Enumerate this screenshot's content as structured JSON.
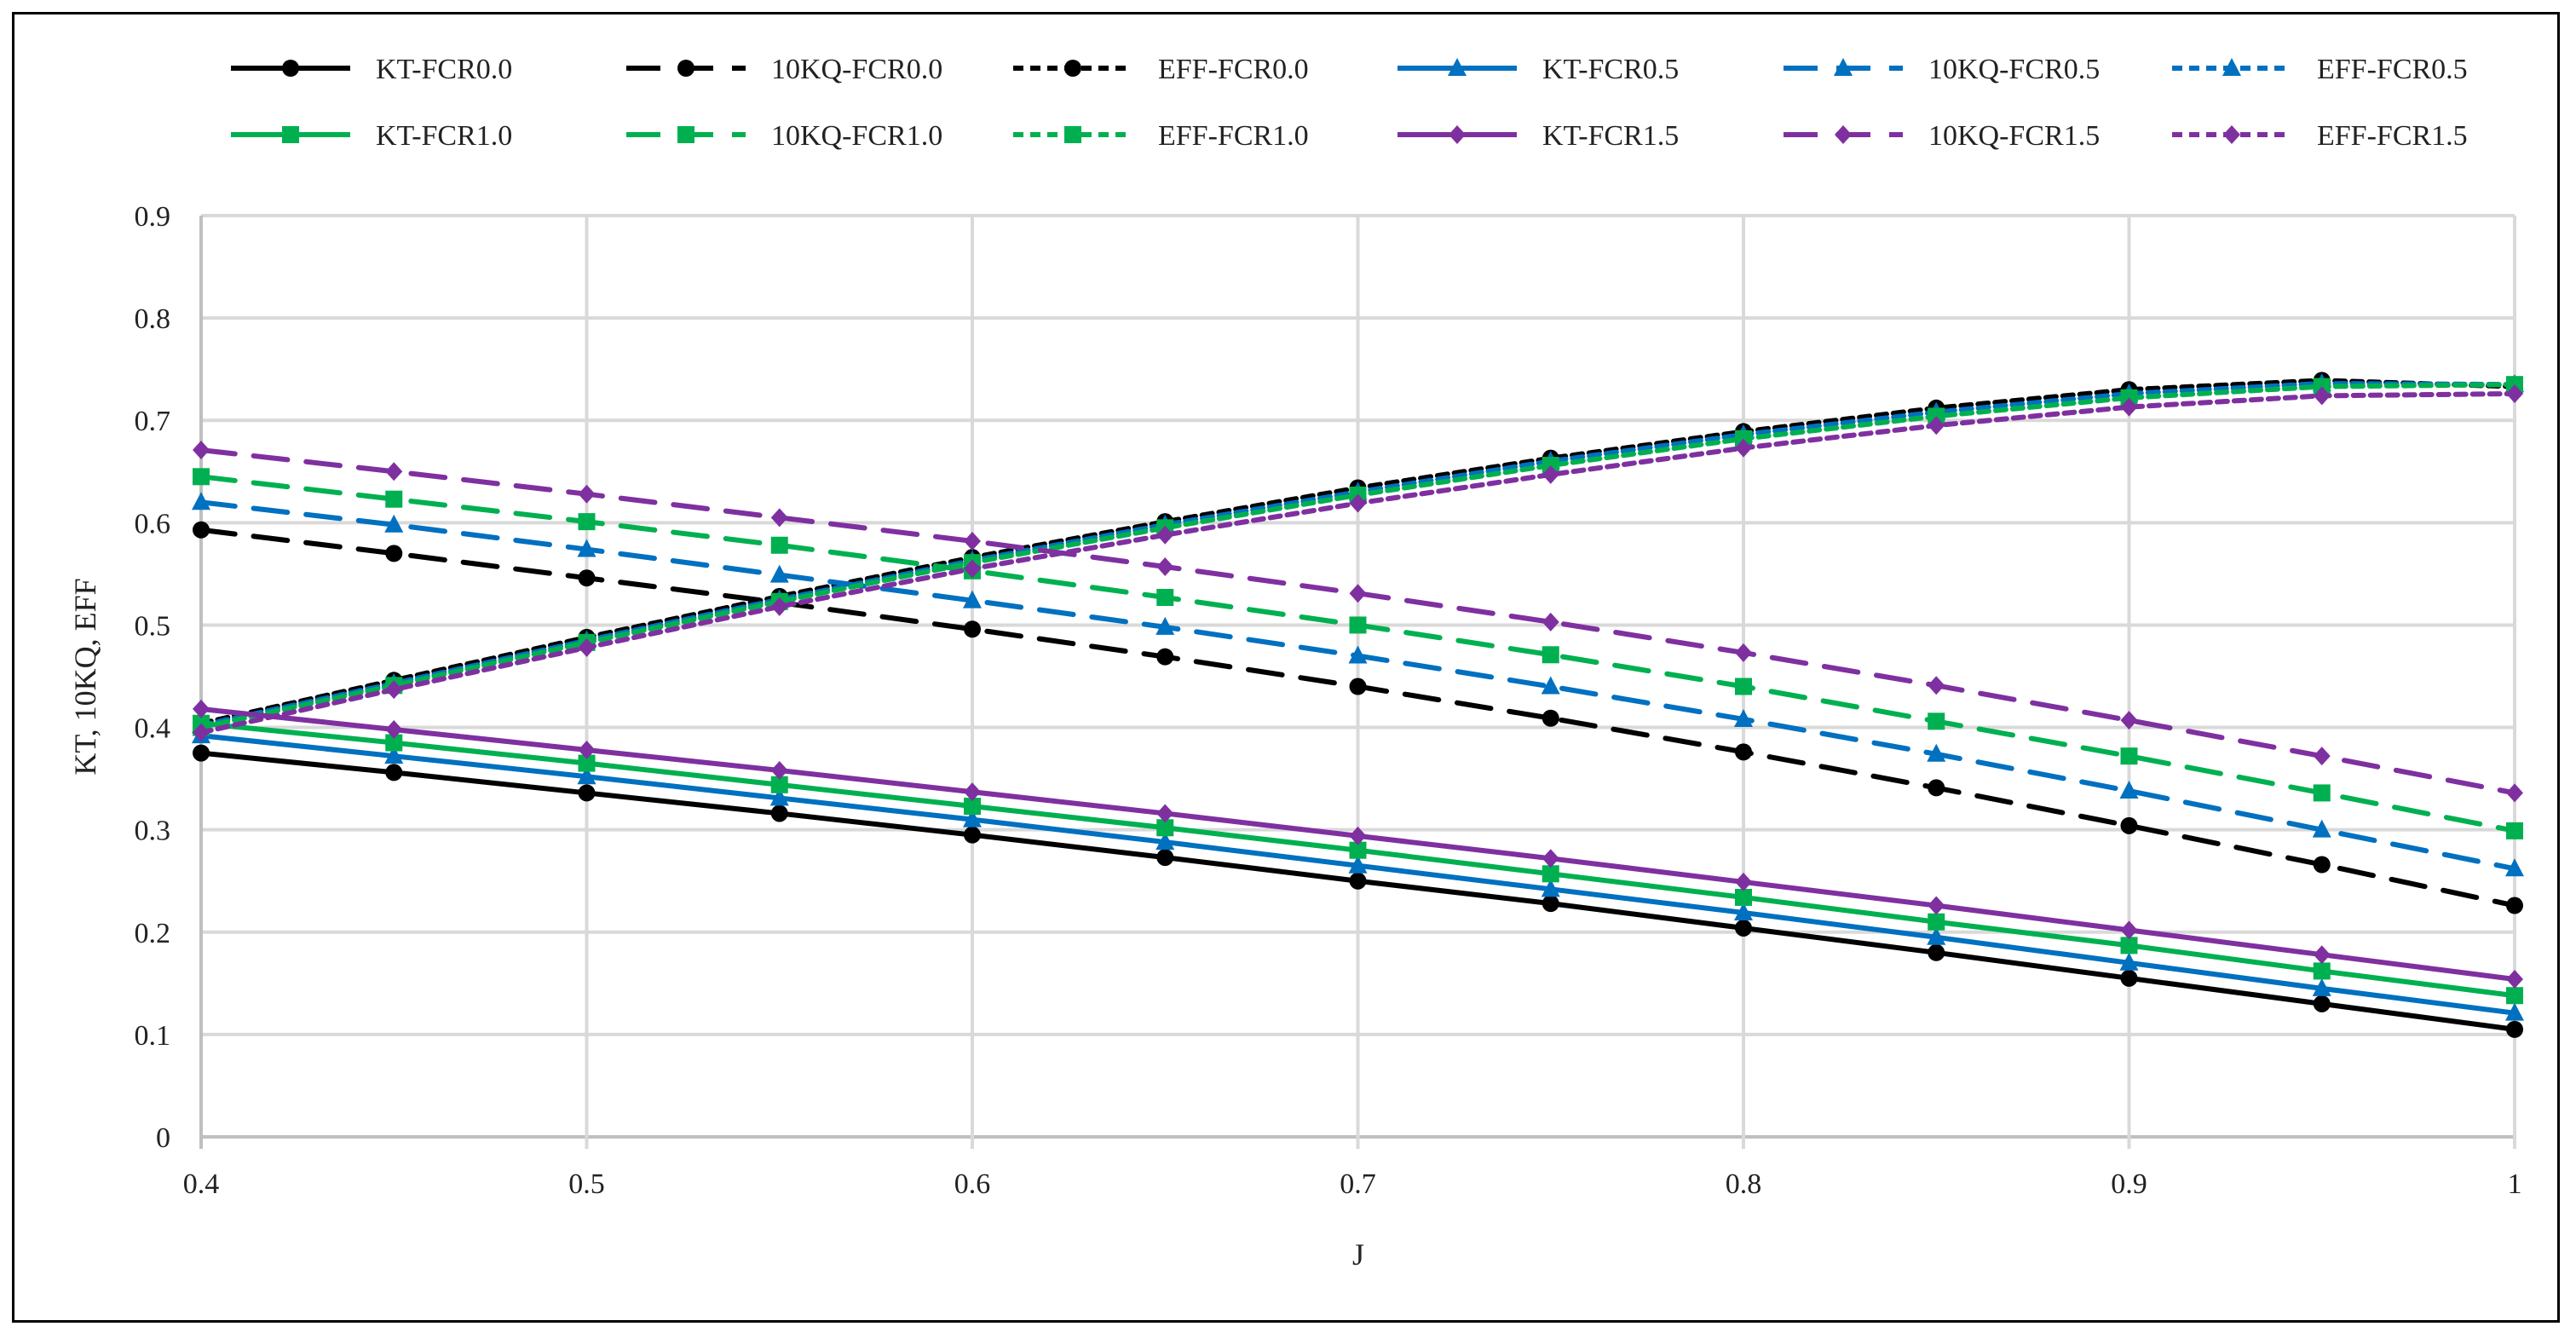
{
  "chart_data": {
    "type": "line",
    "title": "",
    "xlabel": "J",
    "ylabel": "KT, 10KQ, EFF",
    "xlim": [
      0.4,
      1.0
    ],
    "ylim": [
      0,
      0.9
    ],
    "x_ticks": [
      "0.4",
      "0.5",
      "0.6",
      "0.7",
      "0.8",
      "0.9",
      "1"
    ],
    "y_ticks": [
      "0",
      "0.1",
      "0.2",
      "0.3",
      "0.4",
      "0.5",
      "0.6",
      "0.7",
      "0.8",
      "0.9"
    ],
    "grid": true,
    "legend_position": "top",
    "x": [
      0.4,
      0.45,
      0.5,
      0.55,
      0.6,
      0.65,
      0.7,
      0.75,
      0.8,
      0.85,
      0.9,
      0.95,
      1.0
    ],
    "series": [
      {
        "name": "KT-FCR0.0",
        "color": "#000000",
        "style": "solid",
        "marker": "circle",
        "values": [
          0.375,
          0.356,
          0.336,
          0.316,
          0.295,
          0.273,
          0.25,
          0.228,
          0.204,
          0.18,
          0.155,
          0.13,
          0.105
        ]
      },
      {
        "name": "10KQ-FCR0.0",
        "color": "#000000",
        "style": "dash",
        "marker": "circle",
        "values": [
          0.593,
          0.57,
          0.546,
          0.522,
          0.496,
          0.469,
          0.44,
          0.409,
          0.376,
          0.341,
          0.304,
          0.266,
          0.226
        ]
      },
      {
        "name": "EFF-FCR0.0",
        "color": "#000000",
        "style": "dot",
        "marker": "circle",
        "values": [
          0.404,
          0.446,
          0.488,
          0.528,
          0.566,
          0.601,
          0.634,
          0.663,
          0.689,
          0.712,
          0.73,
          0.739,
          0.733
        ]
      },
      {
        "name": "KT-FCR0.5",
        "color": "#0070c0",
        "style": "solid",
        "marker": "triangle",
        "values": [
          0.392,
          0.372,
          0.352,
          0.331,
          0.31,
          0.288,
          0.265,
          0.242,
          0.219,
          0.195,
          0.17,
          0.145,
          0.121
        ]
      },
      {
        "name": "10KQ-FCR0.5",
        "color": "#0070c0",
        "style": "dash",
        "marker": "triangle",
        "values": [
          0.62,
          0.598,
          0.574,
          0.549,
          0.524,
          0.498,
          0.47,
          0.44,
          0.408,
          0.374,
          0.338,
          0.3,
          0.262
        ]
      },
      {
        "name": "EFF-FCR0.5",
        "color": "#0070c0",
        "style": "dot",
        "marker": "triangle",
        "values": [
          0.402,
          0.443,
          0.485,
          0.525,
          0.563,
          0.598,
          0.63,
          0.66,
          0.686,
          0.708,
          0.726,
          0.736,
          0.735
        ]
      },
      {
        "name": "KT-FCR1.0",
        "color": "#00b050",
        "style": "solid",
        "marker": "square",
        "values": [
          0.404,
          0.385,
          0.365,
          0.344,
          0.323,
          0.302,
          0.28,
          0.257,
          0.234,
          0.21,
          0.187,
          0.162,
          0.138
        ]
      },
      {
        "name": "10KQ-FCR1.0",
        "color": "#00b050",
        "style": "dash",
        "marker": "square",
        "values": [
          0.645,
          0.623,
          0.601,
          0.578,
          0.553,
          0.527,
          0.5,
          0.471,
          0.44,
          0.406,
          0.372,
          0.336,
          0.299
        ]
      },
      {
        "name": "EFF-FCR1.0",
        "color": "#00b050",
        "style": "dot",
        "marker": "square",
        "values": [
          0.4,
          0.441,
          0.483,
          0.523,
          0.561,
          0.595,
          0.627,
          0.656,
          0.682,
          0.704,
          0.722,
          0.733,
          0.735
        ]
      },
      {
        "name": "KT-FCR1.5",
        "color": "#7f30a0",
        "style": "solid",
        "marker": "diamond",
        "values": [
          0.418,
          0.398,
          0.378,
          0.358,
          0.337,
          0.316,
          0.294,
          0.272,
          0.249,
          0.226,
          0.202,
          0.178,
          0.154
        ]
      },
      {
        "name": "10KQ-FCR1.5",
        "color": "#7f30a0",
        "style": "dash",
        "marker": "diamond",
        "values": [
          0.671,
          0.65,
          0.628,
          0.605,
          0.582,
          0.557,
          0.531,
          0.503,
          0.473,
          0.441,
          0.407,
          0.372,
          0.336
        ]
      },
      {
        "name": "EFF-FCR1.5",
        "color": "#7f30a0",
        "style": "dot",
        "marker": "diamond",
        "values": [
          0.395,
          0.437,
          0.478,
          0.518,
          0.555,
          0.588,
          0.619,
          0.647,
          0.673,
          0.695,
          0.713,
          0.724,
          0.726
        ]
      }
    ]
  }
}
